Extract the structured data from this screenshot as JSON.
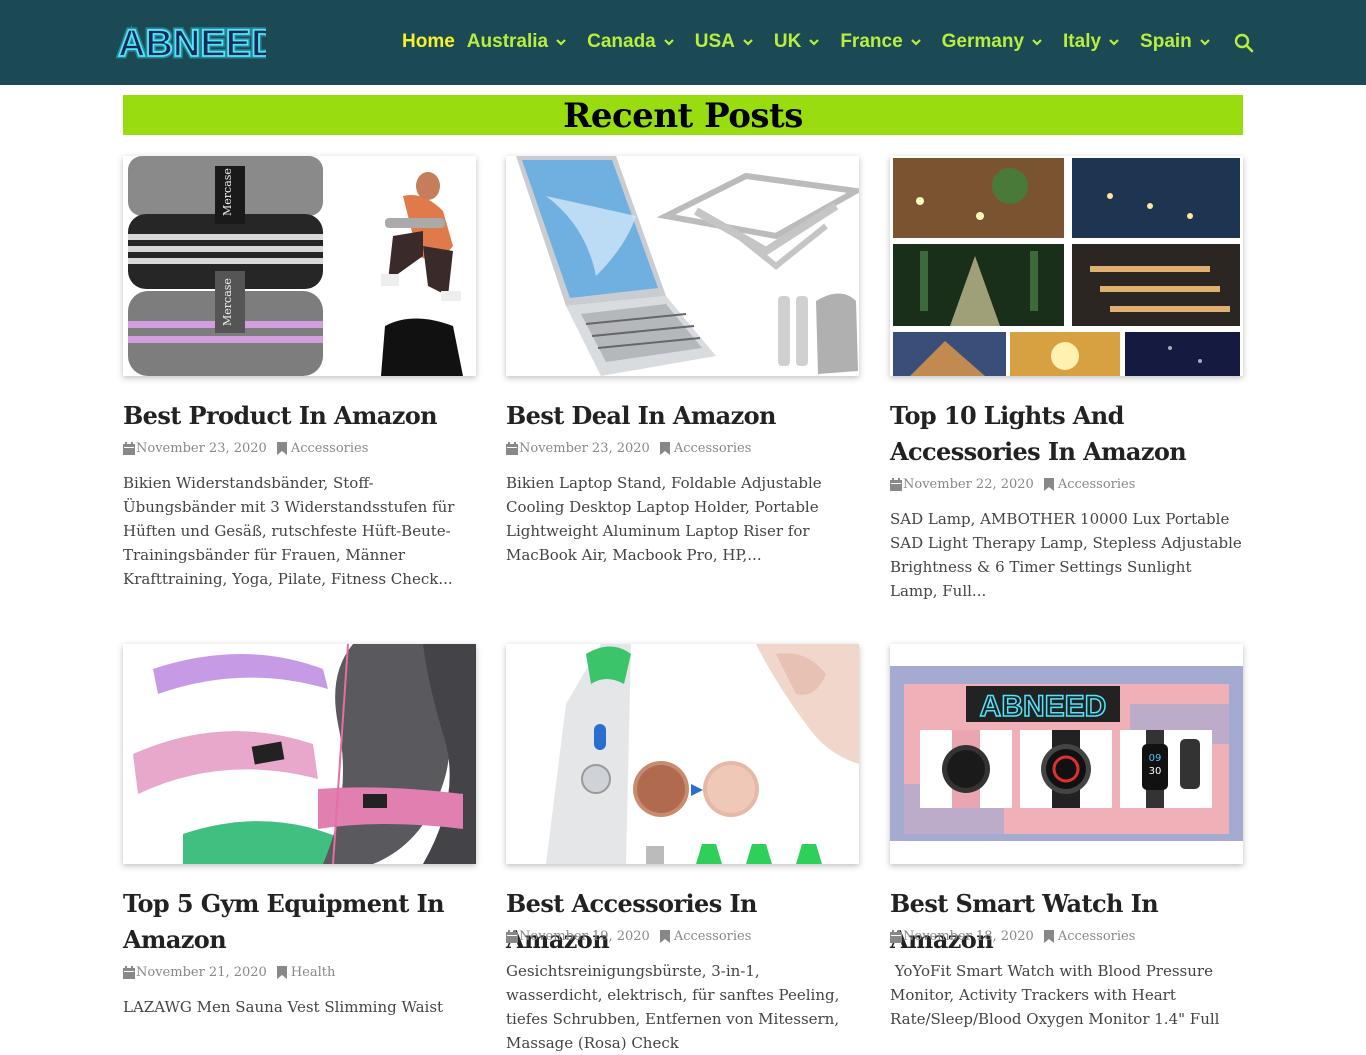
{
  "site": {
    "logo_text": "ABNEED"
  },
  "nav": {
    "items": [
      {
        "label": "Home"
      },
      {
        "label": "Australia"
      },
      {
        "label": "Canada"
      },
      {
        "label": "USA"
      },
      {
        "label": "UK"
      },
      {
        "label": "France"
      },
      {
        "label": "Germany"
      },
      {
        "label": "Italy"
      },
      {
        "label": "Spain"
      }
    ],
    "search_icon": "search-icon"
  },
  "section": {
    "title": "Recent Posts"
  },
  "posts": [
    {
      "title": "Best Product In Amazon",
      "date": "November 23, 2020",
      "category": "Accessories",
      "excerpt": "Bikien Widerstandsbänder, Stoff-Übungsbänder mit 3 Widerstandsstufen für Hüften und Gesäß, rutschfeste Hüft-Beute-Trainingsbänder für Frauen, Männer Krafttraining, Yoga, Pilate, Fitness Check...",
      "thumb_brand": "Mercase"
    },
    {
      "title": "Best Deal In Amazon",
      "date": "November 23, 2020",
      "category": "Accessories",
      "excerpt": "Bikien Laptop Stand, Foldable Adjustable Cooling Desktop Laptop Holder, Portable Lightweight Aluminum Laptop Riser for MacBook Air, Macbook Pro, HP,..."
    },
    {
      "title": "Top 10 Lights And Accessories In Amazon",
      "date": "November 22, 2020",
      "category": "Accessories",
      "excerpt": "SAD Lamp, AMBOTHER 10000 Lux Portable SAD Light Therapy Lamp, Stepless Adjustable Brightness & 6 Timer Settings Sunlight Lamp, Full..."
    },
    {
      "title": "Top 5 Gym Equipment In Amazon",
      "date": "November 21, 2020",
      "category": "Health",
      "excerpt": "LAZAWG Men Sauna Vest Slimming Waist"
    },
    {
      "title": "Best Accessories In Amazon",
      "date": "November 19, 2020",
      "category": "Accessories",
      "excerpt": "Gesichtsreinigungsbürste, 3-in-1, wasserdicht, elektrisch, für sanftes Peeling, tiefes Schrubben, Entfernen von Mitessern, Massage (Rosa) Check"
    },
    {
      "title": "Best Smart Watch In Amazon",
      "date": "November 18, 2020",
      "category": "Accessories",
      "excerpt": " YoYoFit Smart Watch with Blood Pressure Monitor, Activity Trackers with Heart Rate/Sleep/Blood Oxygen Monitor 1.4\" Full",
      "thumb_logo": "ABNEED",
      "thumb_watch_digits": [
        "09",
        "30"
      ]
    }
  ],
  "colors": {
    "header_bg": "#1b4a55",
    "nav_text": "#b9ee3e",
    "nav_active": "#f5f229",
    "banner_bg": "#99dd11"
  }
}
